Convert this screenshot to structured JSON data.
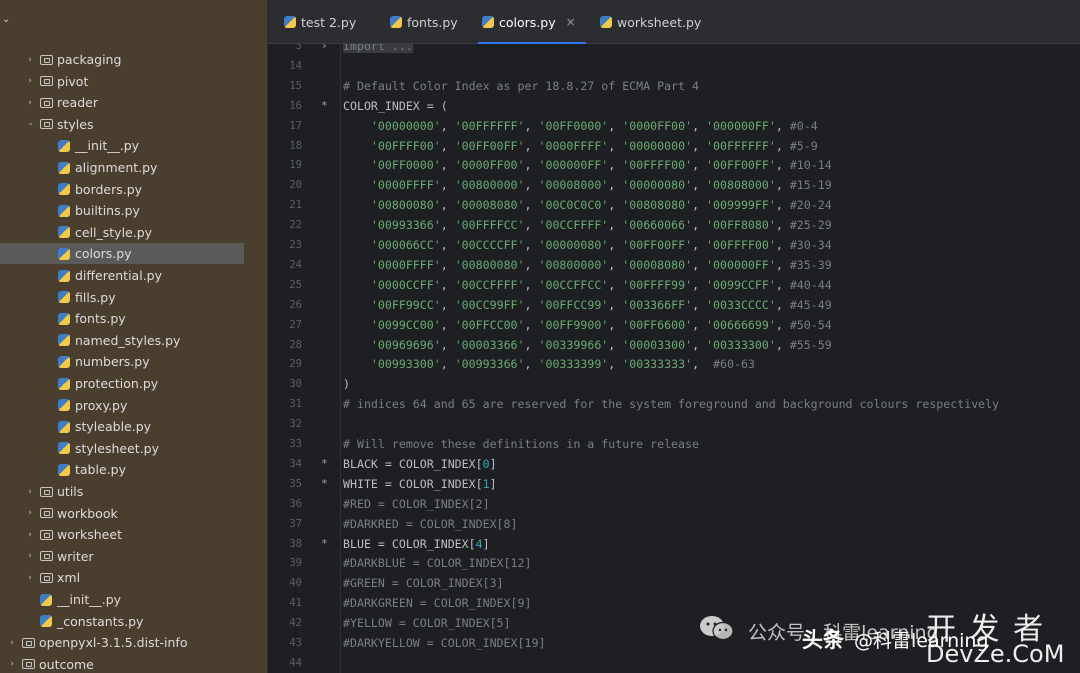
{
  "tree": {
    "rows": [
      {
        "label": "packaging",
        "type": "folder"
      },
      {
        "label": "pivot",
        "type": "folder"
      },
      {
        "label": "reader",
        "type": "folder"
      },
      {
        "label": "styles",
        "type": "folder",
        "open": true
      },
      {
        "label": "__init__.py",
        "type": "py"
      },
      {
        "label": "alignment.py",
        "type": "py"
      },
      {
        "label": "borders.py",
        "type": "py"
      },
      {
        "label": "builtins.py",
        "type": "py"
      },
      {
        "label": "cell_style.py",
        "type": "py"
      },
      {
        "label": "colors.py",
        "type": "py",
        "selected": true
      },
      {
        "label": "differential.py",
        "type": "py"
      },
      {
        "label": "fills.py",
        "type": "py"
      },
      {
        "label": "fonts.py",
        "type": "py"
      },
      {
        "label": "named_styles.py",
        "type": "py"
      },
      {
        "label": "numbers.py",
        "type": "py"
      },
      {
        "label": "protection.py",
        "type": "py"
      },
      {
        "label": "proxy.py",
        "type": "py"
      },
      {
        "label": "styleable.py",
        "type": "py"
      },
      {
        "label": "stylesheet.py",
        "type": "py"
      },
      {
        "label": "table.py",
        "type": "py"
      },
      {
        "label": "utils",
        "type": "folder"
      },
      {
        "label": "workbook",
        "type": "folder"
      },
      {
        "label": "worksheet",
        "type": "folder"
      },
      {
        "label": "writer",
        "type": "folder"
      },
      {
        "label": "xml",
        "type": "folder"
      },
      {
        "label": "__init__.py",
        "type": "py"
      },
      {
        "label": "_constants.py",
        "type": "py"
      },
      {
        "label": "openpyxl-3.1.5.dist-info",
        "type": "folder"
      },
      {
        "label": "outcome",
        "type": "folder"
      }
    ]
  },
  "tabs": [
    {
      "label": "test 2.py"
    },
    {
      "label": "fonts.py"
    },
    {
      "label": "colors.py",
      "active": true,
      "close": "×"
    },
    {
      "label": "worksheet.py"
    }
  ],
  "editor": {
    "lines": [
      {
        "n": "3",
        "mark": "›",
        "tokens": [
          [
            "fold",
            "import ..."
          ]
        ]
      },
      {
        "n": "14",
        "tokens": []
      },
      {
        "n": "15",
        "tokens": [
          [
            "comment",
            "# Default Color Index as per 18.8.27 of ECMA Part 4"
          ]
        ]
      },
      {
        "n": "16",
        "mark": "*",
        "tokens": [
          [
            "plain",
            "COLOR_INDEX = ("
          ]
        ]
      },
      {
        "n": "17",
        "tokens": [
          [
            "plain",
            "    "
          ],
          [
            "string",
            "'00000000'"
          ],
          [
            "plain",
            ", "
          ],
          [
            "string",
            "'00FFFFFF'"
          ],
          [
            "plain",
            ", "
          ],
          [
            "string",
            "'00FF0000'"
          ],
          [
            "plain",
            ", "
          ],
          [
            "string",
            "'0000FF00'"
          ],
          [
            "plain",
            ", "
          ],
          [
            "string",
            "'000000FF'"
          ],
          [
            "plain",
            ", "
          ],
          [
            "comment",
            "#0-4"
          ]
        ]
      },
      {
        "n": "18",
        "tokens": [
          [
            "plain",
            "    "
          ],
          [
            "string",
            "'00FFFF00'"
          ],
          [
            "plain",
            ", "
          ],
          [
            "string",
            "'00FF00FF'"
          ],
          [
            "plain",
            ", "
          ],
          [
            "string",
            "'0000FFFF'"
          ],
          [
            "plain",
            ", "
          ],
          [
            "string",
            "'00000000'"
          ],
          [
            "plain",
            ", "
          ],
          [
            "string",
            "'00FFFFFF'"
          ],
          [
            "plain",
            ", "
          ],
          [
            "comment",
            "#5-9"
          ]
        ]
      },
      {
        "n": "19",
        "tokens": [
          [
            "plain",
            "    "
          ],
          [
            "string",
            "'00FF0000'"
          ],
          [
            "plain",
            ", "
          ],
          [
            "string",
            "'0000FF00'"
          ],
          [
            "plain",
            ", "
          ],
          [
            "string",
            "'000000FF'"
          ],
          [
            "plain",
            ", "
          ],
          [
            "string",
            "'00FFFF00'"
          ],
          [
            "plain",
            ", "
          ],
          [
            "string",
            "'00FF00FF'"
          ],
          [
            "plain",
            ", "
          ],
          [
            "comment",
            "#10-14"
          ]
        ]
      },
      {
        "n": "20",
        "tokens": [
          [
            "plain",
            "    "
          ],
          [
            "string",
            "'0000FFFF'"
          ],
          [
            "plain",
            ", "
          ],
          [
            "string",
            "'00800000'"
          ],
          [
            "plain",
            ", "
          ],
          [
            "string",
            "'00008000'"
          ],
          [
            "plain",
            ", "
          ],
          [
            "string",
            "'00000080'"
          ],
          [
            "plain",
            ", "
          ],
          [
            "string",
            "'00808000'"
          ],
          [
            "plain",
            ", "
          ],
          [
            "comment",
            "#15-19"
          ]
        ]
      },
      {
        "n": "21",
        "tokens": [
          [
            "plain",
            "    "
          ],
          [
            "string",
            "'00800080'"
          ],
          [
            "plain",
            ", "
          ],
          [
            "string",
            "'00008080'"
          ],
          [
            "plain",
            ", "
          ],
          [
            "string",
            "'00C0C0C0'"
          ],
          [
            "plain",
            ", "
          ],
          [
            "string",
            "'00808080'"
          ],
          [
            "plain",
            ", "
          ],
          [
            "string",
            "'009999FF'"
          ],
          [
            "plain",
            ", "
          ],
          [
            "comment",
            "#20-24"
          ]
        ]
      },
      {
        "n": "22",
        "tokens": [
          [
            "plain",
            "    "
          ],
          [
            "string",
            "'00993366'"
          ],
          [
            "plain",
            ", "
          ],
          [
            "string",
            "'00FFFFCC'"
          ],
          [
            "plain",
            ", "
          ],
          [
            "string",
            "'00CCFFFF'"
          ],
          [
            "plain",
            ", "
          ],
          [
            "string",
            "'00660066'"
          ],
          [
            "plain",
            ", "
          ],
          [
            "string",
            "'00FF8080'"
          ],
          [
            "plain",
            ", "
          ],
          [
            "comment",
            "#25-29"
          ]
        ]
      },
      {
        "n": "23",
        "tokens": [
          [
            "plain",
            "    "
          ],
          [
            "string",
            "'000066CC'"
          ],
          [
            "plain",
            ", "
          ],
          [
            "string",
            "'00CCCCFF'"
          ],
          [
            "plain",
            ", "
          ],
          [
            "string",
            "'00000080'"
          ],
          [
            "plain",
            ", "
          ],
          [
            "string",
            "'00FF00FF'"
          ],
          [
            "plain",
            ", "
          ],
          [
            "string",
            "'00FFFF00'"
          ],
          [
            "plain",
            ", "
          ],
          [
            "comment",
            "#30-34"
          ]
        ]
      },
      {
        "n": "24",
        "tokens": [
          [
            "plain",
            "    "
          ],
          [
            "string",
            "'0000FFFF'"
          ],
          [
            "plain",
            ", "
          ],
          [
            "string",
            "'00800080'"
          ],
          [
            "plain",
            ", "
          ],
          [
            "string",
            "'00800000'"
          ],
          [
            "plain",
            ", "
          ],
          [
            "string",
            "'00008080'"
          ],
          [
            "plain",
            ", "
          ],
          [
            "string",
            "'000000FF'"
          ],
          [
            "plain",
            ", "
          ],
          [
            "comment",
            "#35-39"
          ]
        ]
      },
      {
        "n": "25",
        "tokens": [
          [
            "plain",
            "    "
          ],
          [
            "string",
            "'0000CCFF'"
          ],
          [
            "plain",
            ", "
          ],
          [
            "string",
            "'00CCFFFF'"
          ],
          [
            "plain",
            ", "
          ],
          [
            "string",
            "'00CCFFCC'"
          ],
          [
            "plain",
            ", "
          ],
          [
            "string",
            "'00FFFF99'"
          ],
          [
            "plain",
            ", "
          ],
          [
            "string",
            "'0099CCFF'"
          ],
          [
            "plain",
            ", "
          ],
          [
            "comment",
            "#40-44"
          ]
        ]
      },
      {
        "n": "26",
        "tokens": [
          [
            "plain",
            "    "
          ],
          [
            "string",
            "'00FF99CC'"
          ],
          [
            "plain",
            ", "
          ],
          [
            "string",
            "'00CC99FF'"
          ],
          [
            "plain",
            ", "
          ],
          [
            "string",
            "'00FFCC99'"
          ],
          [
            "plain",
            ", "
          ],
          [
            "string",
            "'003366FF'"
          ],
          [
            "plain",
            ", "
          ],
          [
            "string",
            "'0033CCCC'"
          ],
          [
            "plain",
            ", "
          ],
          [
            "comment",
            "#45-49"
          ]
        ]
      },
      {
        "n": "27",
        "tokens": [
          [
            "plain",
            "    "
          ],
          [
            "string",
            "'0099CC00'"
          ],
          [
            "plain",
            ", "
          ],
          [
            "string",
            "'00FFCC00'"
          ],
          [
            "plain",
            ", "
          ],
          [
            "string",
            "'00FF9900'"
          ],
          [
            "plain",
            ", "
          ],
          [
            "string",
            "'00FF6600'"
          ],
          [
            "plain",
            ", "
          ],
          [
            "string",
            "'00666699'"
          ],
          [
            "plain",
            ", "
          ],
          [
            "comment",
            "#50-54"
          ]
        ]
      },
      {
        "n": "28",
        "tokens": [
          [
            "plain",
            "    "
          ],
          [
            "string",
            "'00969696'"
          ],
          [
            "plain",
            ", "
          ],
          [
            "string",
            "'00003366'"
          ],
          [
            "plain",
            ", "
          ],
          [
            "string",
            "'00339966'"
          ],
          [
            "plain",
            ", "
          ],
          [
            "string",
            "'00003300'"
          ],
          [
            "plain",
            ", "
          ],
          [
            "string",
            "'00333300'"
          ],
          [
            "plain",
            ", "
          ],
          [
            "comment",
            "#55-59"
          ]
        ]
      },
      {
        "n": "29",
        "tokens": [
          [
            "plain",
            "    "
          ],
          [
            "string",
            "'00993300'"
          ],
          [
            "plain",
            ", "
          ],
          [
            "string",
            "'00993366'"
          ],
          [
            "plain",
            ", "
          ],
          [
            "string",
            "'00333399'"
          ],
          [
            "plain",
            ", "
          ],
          [
            "string",
            "'00333333'"
          ],
          [
            "plain",
            ",  "
          ],
          [
            "comment",
            "#60-63"
          ]
        ]
      },
      {
        "n": "30",
        "tokens": [
          [
            "plain",
            ")"
          ]
        ]
      },
      {
        "n": "31",
        "tokens": [
          [
            "comment",
            "# indices 64 and 65 are reserved for the system foreground and background colours respectively"
          ]
        ]
      },
      {
        "n": "32",
        "tokens": []
      },
      {
        "n": "33",
        "tokens": [
          [
            "comment",
            "# Will remove these definitions in a future release"
          ]
        ]
      },
      {
        "n": "34",
        "mark": "*",
        "tokens": [
          [
            "plain",
            "BLACK = COLOR_INDEX["
          ],
          [
            "number",
            "0"
          ],
          [
            "plain",
            "]"
          ]
        ]
      },
      {
        "n": "35",
        "mark": "*",
        "tokens": [
          [
            "plain",
            "WHITE = COLOR_INDEX["
          ],
          [
            "number",
            "1"
          ],
          [
            "plain",
            "]"
          ]
        ]
      },
      {
        "n": "36",
        "tokens": [
          [
            "comment",
            "#RED = COLOR_INDEX[2]"
          ]
        ]
      },
      {
        "n": "37",
        "tokens": [
          [
            "comment",
            "#DARKRED = COLOR_INDEX[8]"
          ]
        ]
      },
      {
        "n": "38",
        "mark": "*",
        "tokens": [
          [
            "plain",
            "BLUE = COLOR_INDEX["
          ],
          [
            "number",
            "4"
          ],
          [
            "plain",
            "]"
          ]
        ]
      },
      {
        "n": "39",
        "tokens": [
          [
            "comment",
            "#DARKBLUE = COLOR_INDEX[12]"
          ]
        ]
      },
      {
        "n": "40",
        "tokens": [
          [
            "comment",
            "#GREEN = COLOR_INDEX[3]"
          ]
        ]
      },
      {
        "n": "41",
        "tokens": [
          [
            "comment",
            "#DARKGREEN = COLOR_INDEX[9]"
          ]
        ]
      },
      {
        "n": "42",
        "tokens": [
          [
            "comment",
            "#YELLOW = COLOR_INDEX[5]"
          ]
        ]
      },
      {
        "n": "43",
        "tokens": [
          [
            "comment",
            "#DARKYELLOW = COLOR_INDEX[19]"
          ]
        ]
      },
      {
        "n": "44",
        "tokens": []
      }
    ]
  },
  "watermark": {
    "wechat": "公众号 · 科雷learning",
    "toutiao": "头条",
    "handle": "@科雷learning",
    "site_cn": "开 发 者",
    "site_en": "DevZe.CoM"
  },
  "colors": {
    "accent": "#3574f0",
    "tree_bg": "#4a3e2f",
    "editor_bg": "#1e1f22",
    "string": "#6aab73",
    "comment": "#7a7e85",
    "number": "#2aacb8"
  }
}
